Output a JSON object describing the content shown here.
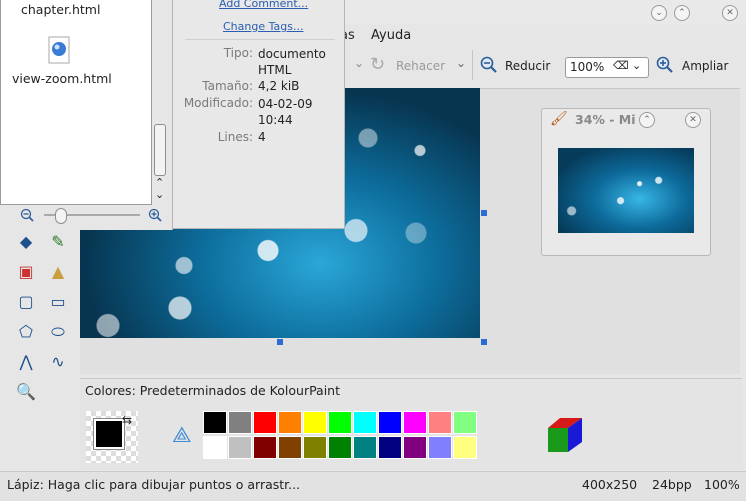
{
  "menubar": {
    "items": [
      "as",
      "Ayuda"
    ]
  },
  "toolbar": {
    "redo_label": "Rehacer",
    "zoom_out_label": "Reducir",
    "zoom_value": "100%",
    "zoom_in_label": "Ampliar"
  },
  "thumbnail": {
    "title": "34% - Mi"
  },
  "files": {
    "items": [
      "chapter.html",
      "view-zoom.html"
    ]
  },
  "info": {
    "add_comment": "Add Comment...",
    "change_tags": "Change Tags...",
    "rows": [
      {
        "label": "Tipo:",
        "value": "documento HTML"
      },
      {
        "label": "Tamaño:",
        "value": "4,2 kiB"
      },
      {
        "label": "Modificado:",
        "value": "04-02-09 10:44"
      },
      {
        "label": "Lines:",
        "value": "4"
      }
    ]
  },
  "colors": {
    "label_prefix": "Colores:",
    "label_scheme": "Predeterminados de KolourPaint",
    "palette_top": [
      "#000000",
      "#808080",
      "#ff0000",
      "#ff8000",
      "#ffff00",
      "#00ff00",
      "#00ffff",
      "#0000ff",
      "#ff00ff",
      "#ff8080",
      "#80ff80"
    ],
    "palette_bottom": [
      "#ffffff",
      "#c0c0c0",
      "#800000",
      "#804000",
      "#808000",
      "#008000",
      "#008080",
      "#000080",
      "#800080",
      "#8080ff",
      "#ffff80"
    ]
  },
  "status": {
    "message": "Lápiz: Haga clic para dibujar puntos o arrastr...",
    "size": "400x250",
    "depth": "24bpp",
    "zoom": "100%"
  }
}
